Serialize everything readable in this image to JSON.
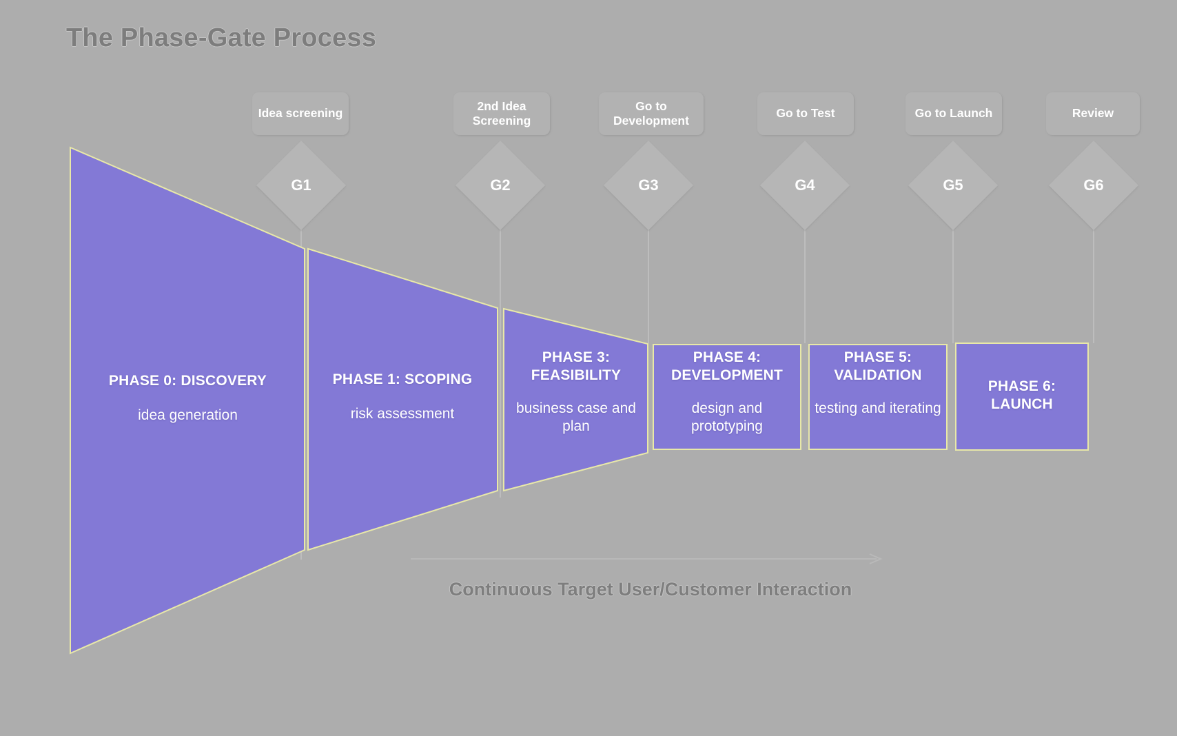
{
  "title": "The Phase-Gate Process",
  "caption": "Continuous Target User/Customer Interaction",
  "colors": {
    "background": "#adadad",
    "phase_fill": "#8379d6",
    "phase_border": "#e8e8a8",
    "gate_chip": "#b2b2b2",
    "gate_diamond": "#b6b6b6",
    "title_text": "#7d7d7d",
    "phase_text": "#ffffff"
  },
  "gates": [
    {
      "id": "G1",
      "label": "Idea screening"
    },
    {
      "id": "G2",
      "label": "2nd Idea Screening"
    },
    {
      "id": "G3",
      "label": "Go to Development"
    },
    {
      "id": "G4",
      "label": "Go to Test"
    },
    {
      "id": "G5",
      "label": "Go to Launch"
    },
    {
      "id": "G6",
      "label": "Review"
    }
  ],
  "phases": [
    {
      "title": "PHASE 0: DISCOVERY",
      "subtitle": "idea generation"
    },
    {
      "title": "PHASE 1: SCOPING",
      "subtitle": "risk assessment"
    },
    {
      "title": "PHASE 3: FEASIBILITY",
      "subtitle": "business case and plan"
    },
    {
      "title": "PHASE 4: DEVELOPMENT",
      "subtitle": "design and prototyping"
    },
    {
      "title": "PHASE 5: VALIDATION",
      "subtitle": "testing and iterating"
    },
    {
      "title": "PHASE 6: LAUNCH",
      "subtitle": ""
    }
  ]
}
